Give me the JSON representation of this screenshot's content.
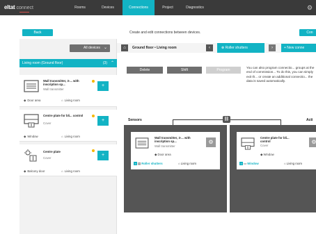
{
  "app": {
    "logo_main": "eltat",
    "logo_sub": "connect",
    "brand_color": "#12b3c4",
    "top_gear_icon": "gear-icon"
  },
  "nav": {
    "tabs": [
      {
        "label": "Rooms",
        "active": false
      },
      {
        "label": "Devices",
        "active": false
      },
      {
        "label": "Connections",
        "active": true
      },
      {
        "label": "Project",
        "active": false
      },
      {
        "label": "Diagnostics",
        "active": false
      }
    ]
  },
  "subbar": {
    "back_label": "Back",
    "description": "Create and edit connections between devices.",
    "connect_label": "Con"
  },
  "left": {
    "filter_value": "All devices",
    "room_label": "Living room (Ground floor)",
    "room_count": "(3)",
    "devices": [
      {
        "title": "Wall transmitter, 3-... with inscription sp...",
        "type": "Wall transmitter",
        "location": "Door area",
        "room": "Living room",
        "icon": "wall-transmitter-icon"
      },
      {
        "title": "Centre plate for bli... control",
        "type": "Cover",
        "location": "Window",
        "room": "Living room",
        "icon": "cover-icon"
      },
      {
        "title": "Centre plate",
        "type": "Cover",
        "location": "Balcony door",
        "room": "Living room",
        "icon": "centre-plate-icon"
      }
    ]
  },
  "toolbar": {
    "breadcrumb": "Ground floor • Living room",
    "selected_group": "Roller shutters",
    "new_connection_label": "+ New conne",
    "delete_label": "Delete",
    "shift_label": "Shift",
    "program_label": "Program"
  },
  "info": {
    "text": "You can also program connectio... groups at the end of commission... To do this, you can simply exit th... or create an additional connectio... the data is saved automatically."
  },
  "sections": {
    "sensors": "Sensors",
    "actuators": "Acti"
  },
  "sensor_card": {
    "title": "Wall transmitter, 3-... with inscription sp...",
    "type": "Wall transmitter",
    "location": "Door area",
    "footer_link": "Roller shutters",
    "footer_room": "Living room"
  },
  "actuator_card": {
    "title": "Centre plate for bli... control",
    "type": "Cover",
    "location": "Window",
    "footer_link": "Window",
    "footer_room": "Living room"
  }
}
